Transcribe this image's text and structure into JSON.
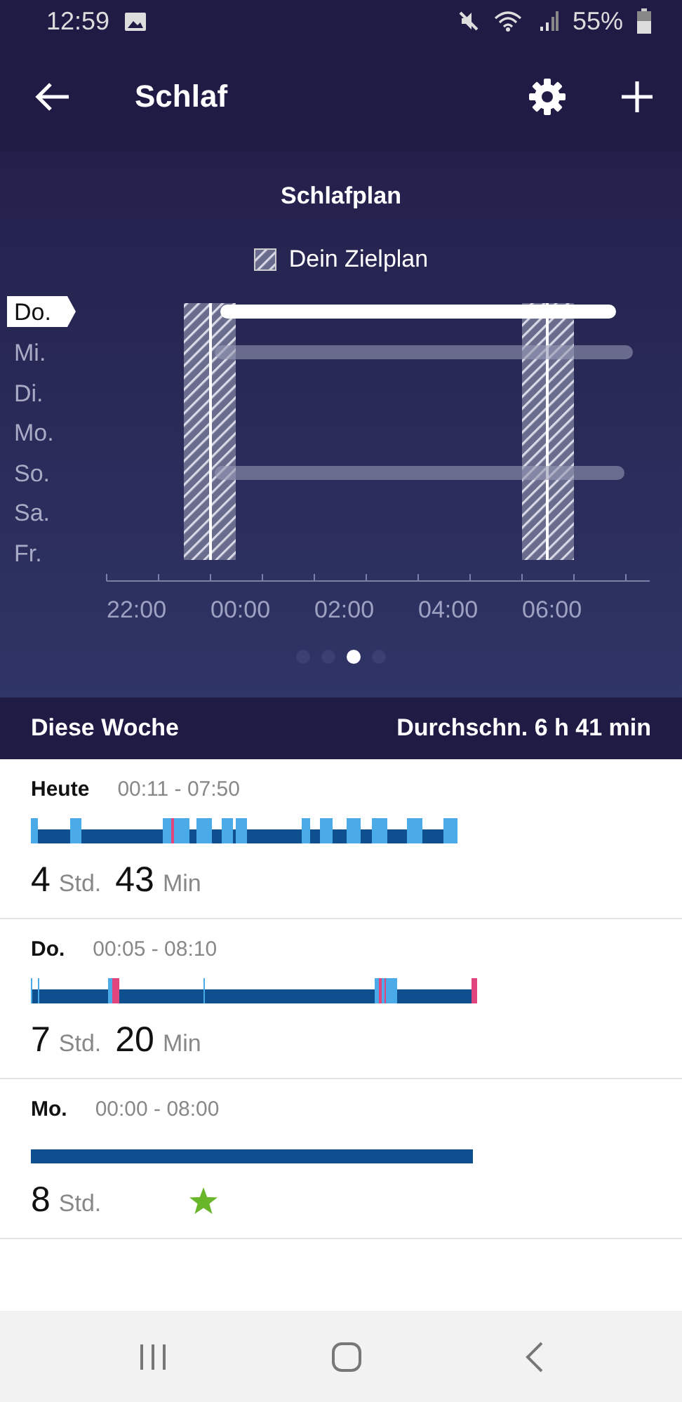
{
  "status_bar": {
    "time": "12:59",
    "battery": "55%"
  },
  "header": {
    "title": "Schlaf"
  },
  "schedule": {
    "title": "Schlafplan",
    "legend": "Dein Zielplan",
    "days": [
      {
        "label": "Do.",
        "selected": true,
        "logged": true
      },
      {
        "label": "Mi.",
        "selected": false,
        "logged": true
      },
      {
        "label": "Di.",
        "selected": false,
        "logged": false
      },
      {
        "label": "Mo.",
        "selected": false,
        "logged": false
      },
      {
        "label": "So.",
        "selected": false,
        "logged": true
      },
      {
        "label": "Sa.",
        "selected": false,
        "logged": false
      },
      {
        "label": "Fr.",
        "selected": false,
        "logged": false
      }
    ],
    "time_labels": [
      "22:00",
      "00:00",
      "02:00",
      "04:00",
      "06:00"
    ]
  },
  "pager": [
    {
      "selected": false
    },
    {
      "selected": false
    },
    {
      "selected": true
    },
    {
      "selected": false
    }
  ],
  "week_bar": {
    "title": "Diese Woche",
    "average": "Durchschn. 6 h 41 min"
  },
  "entries": [
    {
      "day": "Heute",
      "time_range": "00:11 - 07:50",
      "kind": "stages",
      "duration": [
        {
          "value": "4",
          "unit": "Std."
        },
        {
          "value": "43",
          "unit": "Min"
        }
      ],
      "goal_met": false
    },
    {
      "day": "Do.",
      "time_range": "00:05 - 08:10",
      "kind": "stages",
      "duration": [
        {
          "value": "7",
          "unit": "Std."
        },
        {
          "value": "20",
          "unit": "Min"
        }
      ],
      "goal_met": false
    },
    {
      "day": "Mo.",
      "time_range": "00:00 - 08:00",
      "kind": "plain",
      "duration": [
        {
          "value": "8",
          "unit": "Std."
        }
      ],
      "goal_met": true
    }
  ]
}
